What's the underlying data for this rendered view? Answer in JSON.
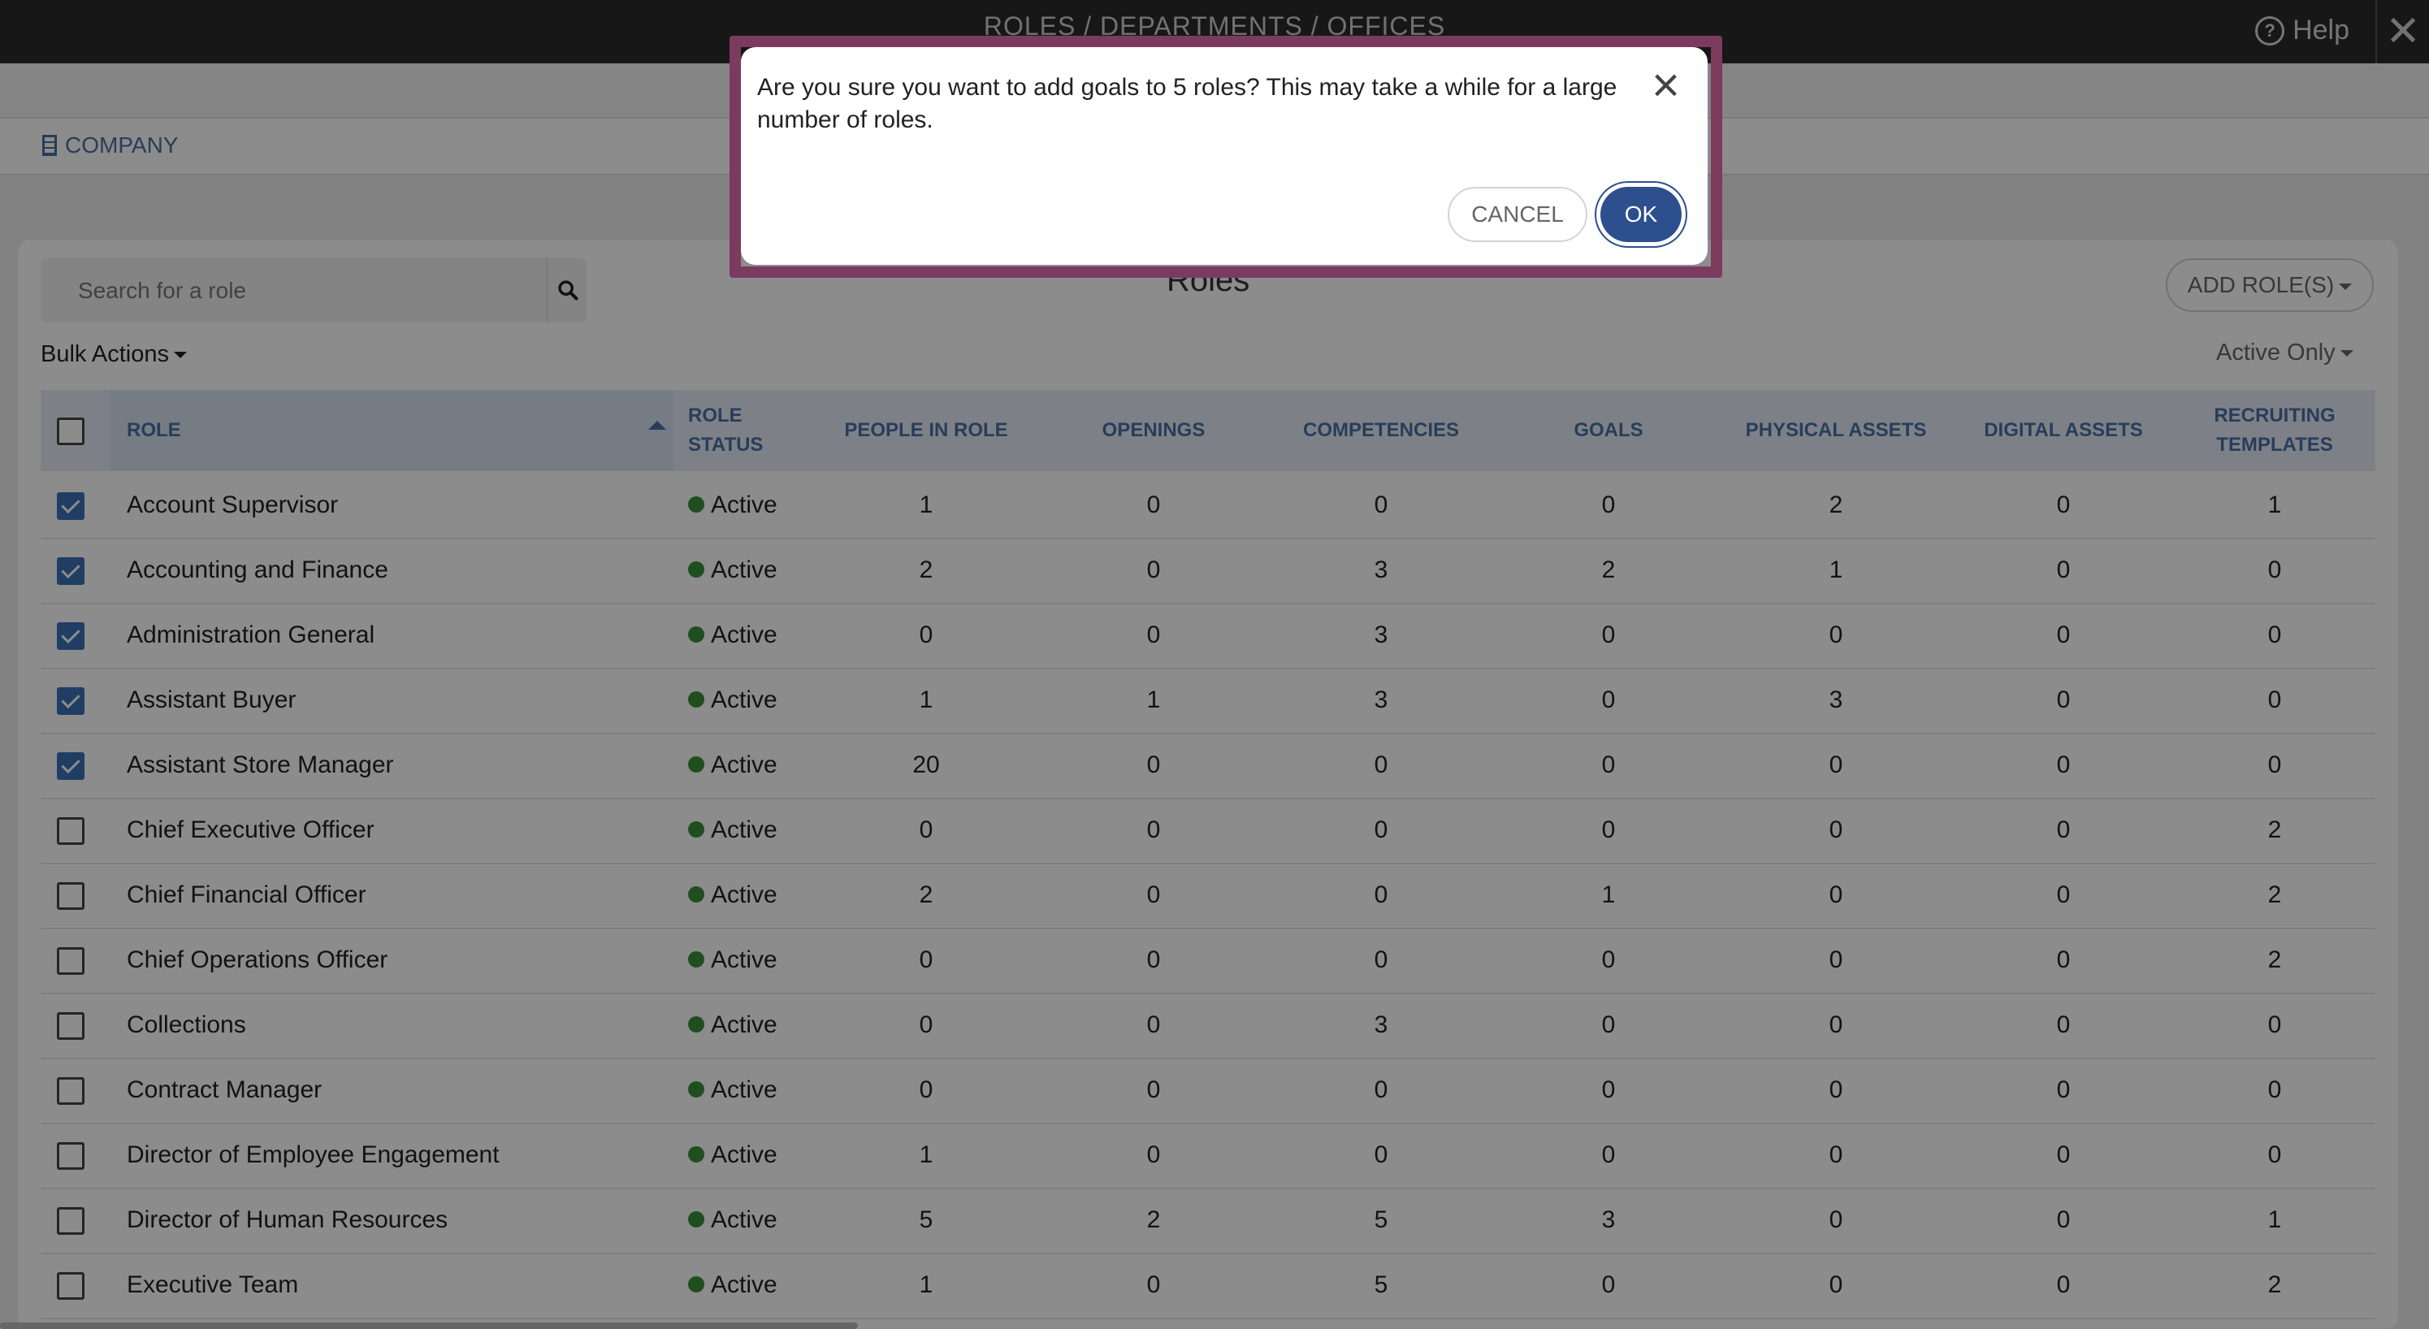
{
  "header": {
    "title": "ROLES / DEPARTMENTS / OFFICES",
    "help_label": "Help",
    "help_icon": "question-circle-icon",
    "close_icon": "close-icon"
  },
  "nav": {
    "company_label": "COMPANY",
    "company_icon": "building-icon"
  },
  "toolbar": {
    "search_placeholder": "Search for a role",
    "search_icon": "search-icon",
    "title": "Roles",
    "add_role_label": "ADD ROLE(S)",
    "bulk_actions_label": "Bulk Actions",
    "filter_label": "Active Only"
  },
  "table": {
    "headers": [
      "ROLE",
      "ROLE STATUS",
      "PEOPLE IN ROLE",
      "OPENINGS",
      "COMPETENCIES",
      "GOALS",
      "PHYSICAL ASSETS",
      "DIGITAL ASSETS",
      "RECRUITING TEMPLATES"
    ],
    "rows": [
      {
        "checked": true,
        "role": "Account Supervisor",
        "status": "Active",
        "people": "1",
        "openings": "0",
        "competencies": "0",
        "goals": "0",
        "physical": "2",
        "digital": "0",
        "recruiting": "1"
      },
      {
        "checked": true,
        "role": "Accounting and Finance",
        "status": "Active",
        "people": "2",
        "openings": "0",
        "competencies": "3",
        "goals": "2",
        "physical": "1",
        "digital": "0",
        "recruiting": "0"
      },
      {
        "checked": true,
        "role": "Administration General",
        "status": "Active",
        "people": "0",
        "openings": "0",
        "competencies": "3",
        "goals": "0",
        "physical": "0",
        "digital": "0",
        "recruiting": "0"
      },
      {
        "checked": true,
        "role": "Assistant Buyer",
        "status": "Active",
        "people": "1",
        "openings": "1",
        "competencies": "3",
        "goals": "0",
        "physical": "3",
        "digital": "0",
        "recruiting": "0"
      },
      {
        "checked": true,
        "role": "Assistant Store Manager",
        "status": "Active",
        "people": "20",
        "openings": "0",
        "competencies": "0",
        "goals": "0",
        "physical": "0",
        "digital": "0",
        "recruiting": "0"
      },
      {
        "checked": false,
        "role": "Chief Executive Officer",
        "status": "Active",
        "people": "0",
        "openings": "0",
        "competencies": "0",
        "goals": "0",
        "physical": "0",
        "digital": "0",
        "recruiting": "2"
      },
      {
        "checked": false,
        "role": "Chief Financial Officer",
        "status": "Active",
        "people": "2",
        "openings": "0",
        "competencies": "0",
        "goals": "1",
        "physical": "0",
        "digital": "0",
        "recruiting": "2"
      },
      {
        "checked": false,
        "role": "Chief Operations Officer",
        "status": "Active",
        "people": "0",
        "openings": "0",
        "competencies": "0",
        "goals": "0",
        "physical": "0",
        "digital": "0",
        "recruiting": "2"
      },
      {
        "checked": false,
        "role": "Collections",
        "status": "Active",
        "people": "0",
        "openings": "0",
        "competencies": "3",
        "goals": "0",
        "physical": "0",
        "digital": "0",
        "recruiting": "0"
      },
      {
        "checked": false,
        "role": "Contract Manager",
        "status": "Active",
        "people": "0",
        "openings": "0",
        "competencies": "0",
        "goals": "0",
        "physical": "0",
        "digital": "0",
        "recruiting": "0"
      },
      {
        "checked": false,
        "role": "Director of Employee Engagement",
        "status": "Active",
        "people": "1",
        "openings": "0",
        "competencies": "0",
        "goals": "0",
        "physical": "0",
        "digital": "0",
        "recruiting": "0"
      },
      {
        "checked": false,
        "role": "Director of Human Resources",
        "status": "Active",
        "people": "5",
        "openings": "2",
        "competencies": "5",
        "goals": "3",
        "physical": "0",
        "digital": "0",
        "recruiting": "1"
      },
      {
        "checked": false,
        "role": "Executive Team",
        "status": "Active",
        "people": "1",
        "openings": "0",
        "competencies": "5",
        "goals": "0",
        "physical": "0",
        "digital": "0",
        "recruiting": "2"
      }
    ]
  },
  "modal": {
    "message": "Are you sure you want to add goals to 5 roles? This may take a while for a large number of roles.",
    "cancel_label": "CANCEL",
    "ok_label": "OK",
    "close_icon": "close-icon"
  },
  "colors": {
    "accent": "#4a6fa5",
    "ok_button": "#2d4f8e",
    "checkbox_checked": "#3b6fb6",
    "status_active": "#3a8f3a",
    "modal_highlight": "#7a3b5f"
  }
}
